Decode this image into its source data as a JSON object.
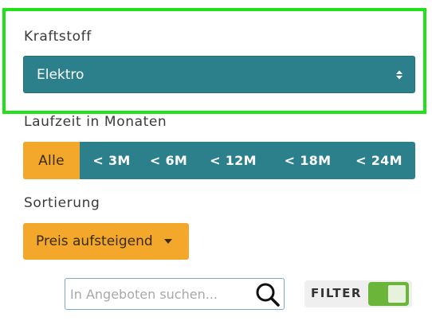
{
  "fuel": {
    "label": "Kraftstoff",
    "selected": "Elektro"
  },
  "runtime": {
    "label": "Laufzeit in Monaten",
    "options": [
      "Alle",
      "< 3M",
      "< 6M",
      "< 12M",
      "< 18M",
      "< 24M"
    ],
    "active": "Alle"
  },
  "sort": {
    "label": "Sortierung",
    "button_label": "Preis aufsteigend"
  },
  "search": {
    "placeholder": "In Angeboten suchen...",
    "value": ""
  },
  "filter": {
    "label": "FILTER",
    "enabled": true
  },
  "colors": {
    "teal": "#2b808c",
    "orange": "#f4a82b",
    "toggle_green": "#6bb53a",
    "highlight_green": "#22e01a"
  }
}
